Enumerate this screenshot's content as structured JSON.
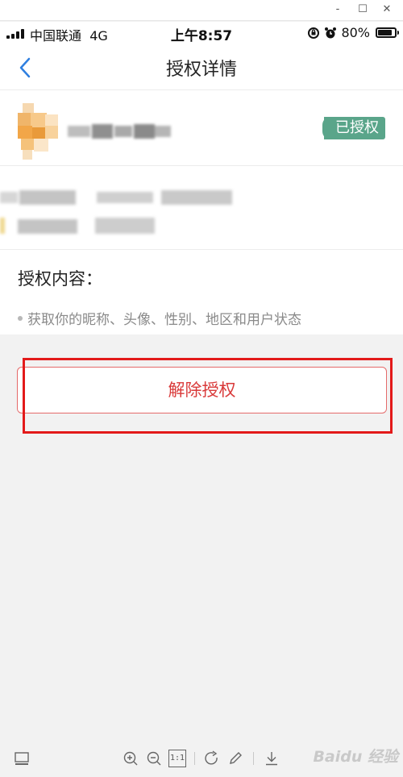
{
  "window": {
    "controls": [
      "-",
      "☐",
      "✕"
    ]
  },
  "status_bar": {
    "carrier": "中国联通",
    "network": "4G",
    "time": "上午8:57",
    "battery": "80%"
  },
  "nav": {
    "title": "授权详情"
  },
  "app": {
    "badge": "已授权"
  },
  "scope": {
    "title": "授权内容：",
    "items": [
      "获取你的昵称、头像、性别、地区和用户状态"
    ]
  },
  "actions": {
    "revoke_label": "解除授权"
  },
  "toolbar": {
    "page_ratio_label": "1:1"
  },
  "watermark": "Baidu 经验",
  "colors": {
    "accent_blue": "#2f7fe0",
    "badge_green": "#5aa58a",
    "danger_red": "#d93a3a",
    "annotation_red": "#e31a1a"
  }
}
